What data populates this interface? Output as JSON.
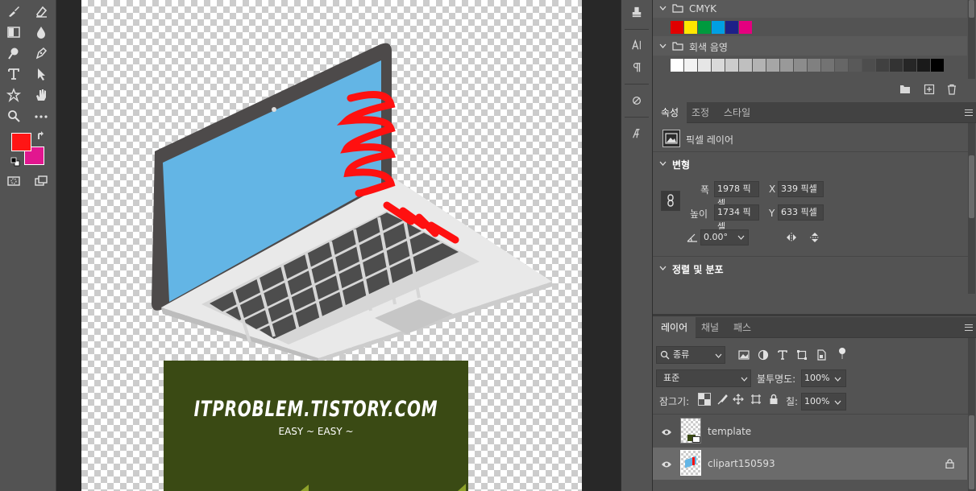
{
  "toolbar": {
    "foreground_color": "#ff1515",
    "background_color": "#e2168f",
    "tools": [
      "brush-icon",
      "eraser-icon",
      "gradient-icon",
      "blur-icon",
      "dodge-icon",
      "pen-icon",
      "type-icon",
      "path-select-icon",
      "shape-icon",
      "hand-icon",
      "zoom-icon",
      "more-icon",
      "quick-mask-icon",
      "screen-mode-icon"
    ]
  },
  "canvas": {
    "banner_title": "ITPROBLEM.TISTORY.COM",
    "banner_subtitle": "EASY ~ EASY ~",
    "banner_color": "#3a4a14"
  },
  "swatches": {
    "groups": [
      {
        "name": "CMYK",
        "colors": [
          "#e00000",
          "#ffe600",
          "#009a3e",
          "#009fe3",
          "#1d2088",
          "#e4007f"
        ]
      },
      {
        "name": "회색 음영",
        "colors": [
          "#ffffff",
          "#f2f2f2",
          "#e6e6e6",
          "#d9d9d9",
          "#cccccc",
          "#bfbfbf",
          "#b3b3b3",
          "#a6a6a6",
          "#999999",
          "#8c8c8c",
          "#808080",
          "#737373",
          "#666666",
          "#595959",
          "#4d4d4d",
          "#404040",
          "#333333",
          "#262626",
          "#1a1a1a",
          "#000000"
        ]
      }
    ]
  },
  "properties": {
    "tabs": [
      "속성",
      "조정",
      "스타일"
    ],
    "layer_type": "픽셀 레이어",
    "transform": {
      "title": "변형",
      "width_label": "폭",
      "width_value": "1978 픽셀",
      "height_label": "높이",
      "height_value": "1734 픽셀",
      "x_label": "X",
      "x_value": "339 픽셀",
      "y_label": "Y",
      "y_value": "633 픽셀",
      "angle_value": "0.00°"
    },
    "align_title": "정렬 및 분포"
  },
  "layers_panel": {
    "tabs": [
      "레이어",
      "채널",
      "패스"
    ],
    "filter_label": "종류",
    "blend_mode": "표준",
    "opacity_label": "불투명도:",
    "opacity_value": "100%",
    "lock_label": "잠그기:",
    "fill_label": "칠:",
    "fill_value": "100%",
    "layers": [
      {
        "name": "template",
        "selected": false,
        "locked": false
      },
      {
        "name": "clipart150593",
        "selected": true,
        "locked": true
      }
    ]
  }
}
